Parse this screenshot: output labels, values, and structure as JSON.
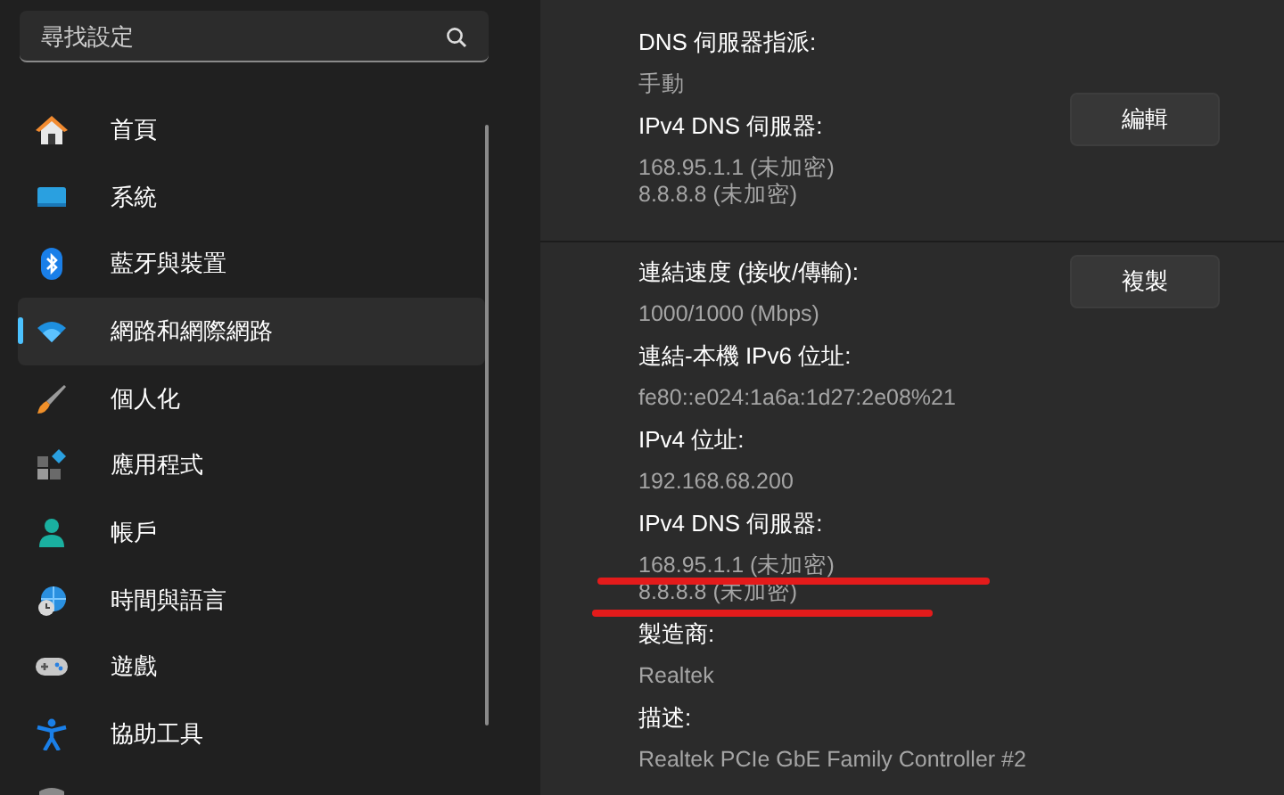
{
  "search": {
    "placeholder": "尋找設定"
  },
  "sidebar": {
    "items": [
      {
        "label": "首頁",
        "selected": false
      },
      {
        "label": "系統",
        "selected": false
      },
      {
        "label": "藍牙與裝置",
        "selected": false
      },
      {
        "label": "網路和網際網路",
        "selected": true
      },
      {
        "label": "個人化",
        "selected": false
      },
      {
        "label": "應用程式",
        "selected": false
      },
      {
        "label": "帳戶",
        "selected": false
      },
      {
        "label": "時間與語言",
        "selected": false
      },
      {
        "label": "遊戲",
        "selected": false
      },
      {
        "label": "協助工具",
        "selected": false
      }
    ]
  },
  "sections": [
    {
      "fields": [
        {
          "label": "DNS 伺服器指派:",
          "values": [
            "手動"
          ]
        },
        {
          "label": "IPv4 DNS 伺服器:",
          "values": [
            "168.95.1.1 (未加密)",
            "8.8.8.8 (未加密)"
          ]
        }
      ],
      "button": "編輯"
    },
    {
      "fields": [
        {
          "label": "連結速度 (接收/傳輸):",
          "values": [
            "1000/1000 (Mbps)"
          ]
        },
        {
          "label": "連結-本機 IPv6 位址:",
          "values": [
            "fe80::e024:1a6a:1d27:2e08%21"
          ]
        },
        {
          "label": "IPv4 位址:",
          "values": [
            "192.168.68.200"
          ]
        },
        {
          "label": "IPv4 DNS 伺服器:",
          "values": [
            "168.95.1.1 (未加密)",
            "8.8.8.8 (未加密)"
          ],
          "annotations": [
            {
              "kind": "underline"
            },
            {
              "kind": "underline"
            }
          ]
        },
        {
          "label": "製造商:",
          "values": [
            "Realtek"
          ]
        },
        {
          "label": "描述:",
          "values": [
            "Realtek PCIe GbE Family Controller #2"
          ]
        }
      ],
      "button": "複製"
    }
  ]
}
